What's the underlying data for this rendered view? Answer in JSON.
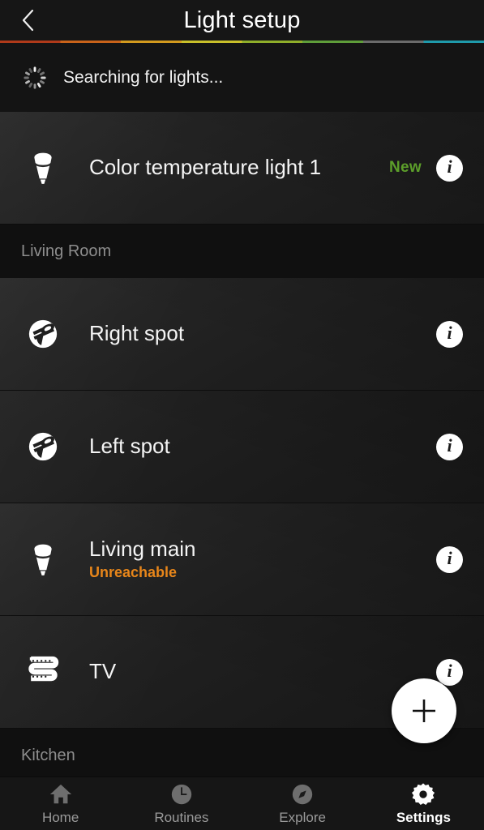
{
  "header": {
    "title": "Light setup",
    "back_icon": "chevron-left-icon",
    "progress_colors": [
      "#b03a1a",
      "#c9631a",
      "#d39a1e",
      "#c9c02a",
      "#8fae2a",
      "#5f9e3a",
      "#6b6b6b",
      "#1f9aab"
    ]
  },
  "searching": {
    "label": "Searching for lights...",
    "icon": "spinner-icon"
  },
  "new_lights": [
    {
      "name": "Color temperature light 1",
      "icon": "bulb-spot-icon",
      "badge": "New",
      "badge_color": "#5c9e2a",
      "info_icon": "info-icon",
      "status": ""
    }
  ],
  "rooms": [
    {
      "name": "Living Room",
      "lights": [
        {
          "name": "Right spot",
          "icon": "ceiling-spot-icon",
          "status": "",
          "info_icon": "info-icon"
        },
        {
          "name": "Left spot",
          "icon": "ceiling-spot-icon",
          "status": "",
          "info_icon": "info-icon"
        },
        {
          "name": "Living main",
          "icon": "bulb-spot-icon",
          "status": "Unreachable",
          "info_icon": "info-icon"
        },
        {
          "name": "TV",
          "icon": "lightstrip-icon",
          "status": "",
          "info_icon": "info-icon"
        }
      ]
    },
    {
      "name": "Kitchen",
      "lights": []
    }
  ],
  "fab": {
    "label": "+",
    "icon": "plus-icon"
  },
  "bottom_nav": {
    "items": [
      {
        "label": "Home",
        "icon": "home-icon",
        "active": false
      },
      {
        "label": "Routines",
        "icon": "clock-icon",
        "active": false
      },
      {
        "label": "Explore",
        "icon": "compass-icon",
        "active": false
      },
      {
        "label": "Settings",
        "icon": "gear-icon",
        "active": true
      }
    ]
  },
  "colors": {
    "background": "#131313",
    "row_background": "#222222",
    "status_unreachable": "#e8861a",
    "badge_new": "#5c9e2a",
    "accent_white": "#ffffff"
  }
}
